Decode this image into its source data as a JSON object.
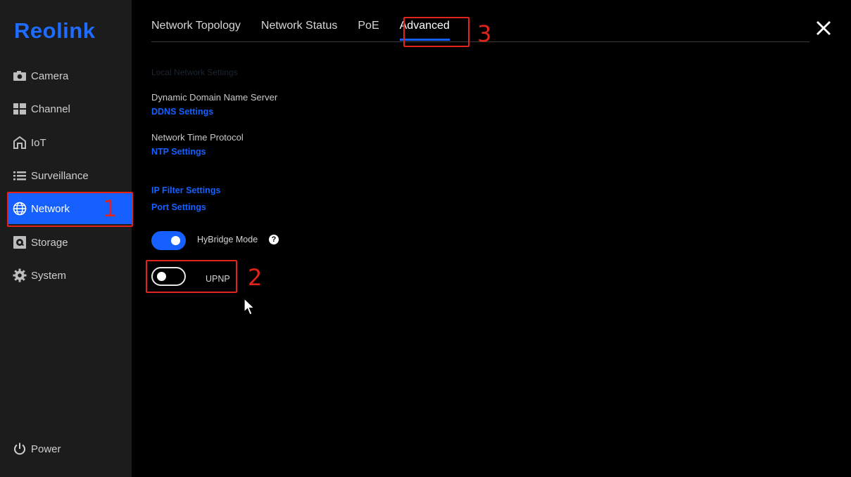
{
  "sidebar": {
    "logo": "Reolink",
    "items": [
      {
        "label": "Camera",
        "icon": "camera-icon"
      },
      {
        "label": "Channel",
        "icon": "grid-icon"
      },
      {
        "label": "IoT",
        "icon": "home-icon"
      },
      {
        "label": "Surveillance",
        "icon": "list-icon"
      },
      {
        "label": "Network",
        "icon": "globe-icon",
        "active": true
      },
      {
        "label": "Storage",
        "icon": "storage-icon"
      },
      {
        "label": "System",
        "icon": "gear-icon"
      }
    ],
    "power_label": "Power"
  },
  "tabs": [
    {
      "label": "Network Topology"
    },
    {
      "label": "Network Status"
    },
    {
      "label": "PoE"
    },
    {
      "label": "Advanced",
      "active": true
    }
  ],
  "content": {
    "local_heading": "Local Network Settings",
    "ddns_label": "Dynamic Domain Name Server",
    "ddns_link": "DDNS Settings",
    "ntp_label": "Network Time Protocol",
    "ntp_link": "NTP Settings",
    "ip_filter_link": "IP Filter Settings",
    "port_link": "Port Settings",
    "hybridge_label": "HyBridge Mode",
    "hybridge_on": true,
    "help_glyph": "?",
    "upnp_label": "UPNP",
    "upnp_on": false
  },
  "annotations": [
    "1",
    "2",
    "3"
  ],
  "colors": {
    "accent": "#1660ff",
    "marker": "#e2231a",
    "sidebar_bg": "#1c1c1c"
  }
}
